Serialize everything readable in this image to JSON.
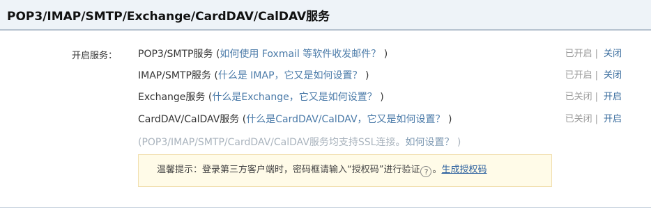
{
  "section": {
    "title": "POP3/IMAP/SMTP/Exchange/CardDAV/CalDAV服务"
  },
  "field_label": "开启服务：",
  "services": [
    {
      "name": "POP3/SMTP服务",
      "paren_open": " (",
      "help_text": "如何使用 Foxmail 等软件收发邮件？",
      "paren_close": " )",
      "status": "已开启",
      "separator": "|",
      "action": "关闭"
    },
    {
      "name": "IMAP/SMTP服务",
      "paren_open": " (",
      "help_text": "什么是 IMAP，它又是如何设置？",
      "paren_close": " )",
      "status": "已开启",
      "separator": "|",
      "action": "关闭"
    },
    {
      "name": "Exchange服务",
      "paren_open": " (",
      "help_text": "什么是Exchange，它又是如何设置？",
      "paren_close": " )",
      "status": "已关闭",
      "separator": "|",
      "action": "开启"
    },
    {
      "name": "CardDAV/CalDAV服务",
      "paren_open": " (",
      "help_text": "什么是CardDAV/CalDAV，它又是如何设置？",
      "paren_close": " )",
      "status": "已关闭",
      "separator": "|",
      "action": "开启"
    }
  ],
  "ssl_note": {
    "text": "(POP3/IMAP/SMTP/CardDAV/CalDAV服务均支持SSL连接。",
    "link": "如何设置？",
    "close": " )"
  },
  "tip": {
    "text": "温馨提示：登录第三方客户端时，密码框请输入“授权码”进行验证",
    "help_icon": "?",
    "after_icon": "。",
    "link": "生成授权码"
  },
  "colors": {
    "header_bg": "#eef3f8",
    "link": "#4a7aa8",
    "status_gray": "#9a9a9a",
    "tip_bg": "#fffbe8",
    "tip_border": "#f1dfae"
  }
}
